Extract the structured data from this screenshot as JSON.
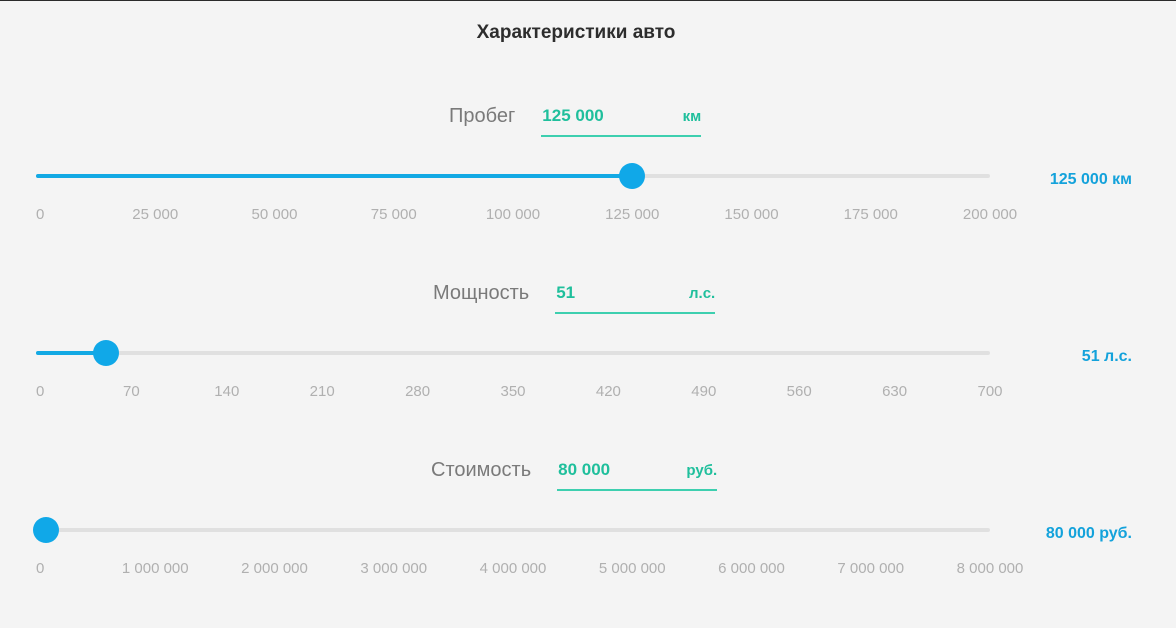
{
  "title": "Характеристики авто",
  "sliders": [
    {
      "label": "Пробег",
      "input_value": "125 000",
      "unit": "км",
      "readout": "125 000 км",
      "min": 0,
      "max": 200000,
      "value": 125000,
      "ticks": [
        "0",
        "25 000",
        "50 000",
        "75 000",
        "100 000",
        "125 000",
        "150 000",
        "175 000",
        "200 000"
      ]
    },
    {
      "label": "Мощность",
      "input_value": "51",
      "unit": "л.с.",
      "readout": "51 л.с.",
      "min": 0,
      "max": 700,
      "value": 51,
      "ticks": [
        "0",
        "70",
        "140",
        "210",
        "280",
        "350",
        "420",
        "490",
        "560",
        "630",
        "700"
      ]
    },
    {
      "label": "Стоимость",
      "input_value": "80 000",
      "unit": "руб.",
      "readout": "80 000 руб.",
      "min": 0,
      "max": 8000000,
      "value": 80000,
      "ticks": [
        "0",
        "1 000 000",
        "2 000 000",
        "3 000 000",
        "4 000 000",
        "5 000 000",
        "6 000 000",
        "7 000 000",
        "8 000 000"
      ]
    }
  ],
  "colors": {
    "accent_blue": "#13a9e4",
    "accent_green": "#1fbf9c",
    "track": "#e0e0e0"
  }
}
